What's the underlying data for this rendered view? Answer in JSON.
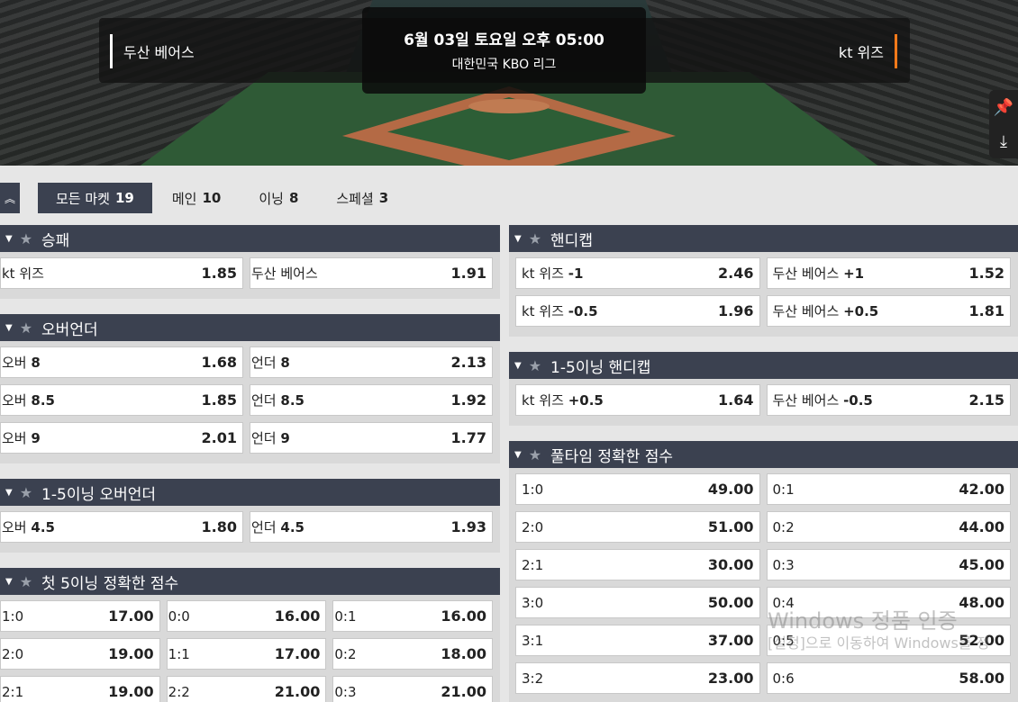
{
  "match": {
    "home_team": "두산 베어스",
    "away_team": "kt 위즈",
    "datetime": "6월 03일 토요일 오후 05:00",
    "league": "대한민국 KBO 리그"
  },
  "tabs": [
    {
      "label": "모든 마켓",
      "count": "19"
    },
    {
      "label": "메인",
      "count": "10"
    },
    {
      "label": "이닝",
      "count": "8"
    },
    {
      "label": "스페셜",
      "count": "3"
    }
  ],
  "left_markets": [
    {
      "title": "승패",
      "rows": [
        [
          {
            "label": "kt 위즈",
            "bold": "",
            "odds": "1.85"
          },
          {
            "label": "두산 베어스",
            "bold": "",
            "odds": "1.91"
          }
        ]
      ]
    },
    {
      "title": "오버언더",
      "rows": [
        [
          {
            "label": "오버",
            "bold": "8",
            "odds": "1.68"
          },
          {
            "label": "언더",
            "bold": "8",
            "odds": "2.13"
          }
        ],
        [
          {
            "label": "오버",
            "bold": "8.5",
            "odds": "1.85"
          },
          {
            "label": "언더",
            "bold": "8.5",
            "odds": "1.92"
          }
        ],
        [
          {
            "label": "오버",
            "bold": "9",
            "odds": "2.01"
          },
          {
            "label": "언더",
            "bold": "9",
            "odds": "1.77"
          }
        ]
      ]
    },
    {
      "title": "1-5이닝 오버언더",
      "rows": [
        [
          {
            "label": "오버",
            "bold": "4.5",
            "odds": "1.80"
          },
          {
            "label": "언더",
            "bold": "4.5",
            "odds": "1.93"
          }
        ]
      ]
    },
    {
      "title": "첫 5이닝 정확한 점수",
      "rows": [
        [
          {
            "label": "1:0",
            "bold": "",
            "odds": "17.00"
          },
          {
            "label": "0:0",
            "bold": "",
            "odds": "16.00"
          },
          {
            "label": "0:1",
            "bold": "",
            "odds": "16.00"
          }
        ],
        [
          {
            "label": "2:0",
            "bold": "",
            "odds": "19.00"
          },
          {
            "label": "1:1",
            "bold": "",
            "odds": "17.00"
          },
          {
            "label": "0:2",
            "bold": "",
            "odds": "18.00"
          }
        ],
        [
          {
            "label": "2:1",
            "bold": "",
            "odds": "19.00"
          },
          {
            "label": "2:2",
            "bold": "",
            "odds": "21.00"
          },
          {
            "label": "0:3",
            "bold": "",
            "odds": "21.00"
          }
        ]
      ]
    }
  ],
  "right_markets": [
    {
      "title": "핸디캡",
      "rows": [
        [
          {
            "label": "kt 위즈",
            "bold": "-1",
            "odds": "2.46"
          },
          {
            "label": "두산 베어스",
            "bold": "+1",
            "odds": "1.52"
          }
        ],
        [
          {
            "label": "kt 위즈",
            "bold": "-0.5",
            "odds": "1.96"
          },
          {
            "label": "두산 베어스",
            "bold": "+0.5",
            "odds": "1.81"
          }
        ]
      ]
    },
    {
      "title": "1-5이닝 핸디캡",
      "rows": [
        [
          {
            "label": "kt 위즈",
            "bold": "+0.5",
            "odds": "1.64"
          },
          {
            "label": "두산 베어스",
            "bold": "-0.5",
            "odds": "2.15"
          }
        ]
      ]
    },
    {
      "title": "풀타임 정확한 점수",
      "rows": [
        [
          {
            "label": "1:0",
            "bold": "",
            "odds": "49.00"
          },
          {
            "label": "0:1",
            "bold": "",
            "odds": "42.00"
          }
        ],
        [
          {
            "label": "2:0",
            "bold": "",
            "odds": "51.00"
          },
          {
            "label": "0:2",
            "bold": "",
            "odds": "44.00"
          }
        ],
        [
          {
            "label": "2:1",
            "bold": "",
            "odds": "30.00"
          },
          {
            "label": "0:3",
            "bold": "",
            "odds": "45.00"
          }
        ],
        [
          {
            "label": "3:0",
            "bold": "",
            "odds": "50.00"
          },
          {
            "label": "0:4",
            "bold": "",
            "odds": "48.00"
          }
        ],
        [
          {
            "label": "3:1",
            "bold": "",
            "odds": "37.00"
          },
          {
            "label": "0:5",
            "bold": "",
            "odds": "52.00"
          }
        ],
        [
          {
            "label": "3:2",
            "bold": "",
            "odds": "23.00"
          },
          {
            "label": "0:6",
            "bold": "",
            "odds": "58.00"
          }
        ]
      ]
    }
  ],
  "watermark": {
    "line1": "Windows 정품 인증",
    "line2": "[설정]으로 이동하여 Windows를 정"
  }
}
